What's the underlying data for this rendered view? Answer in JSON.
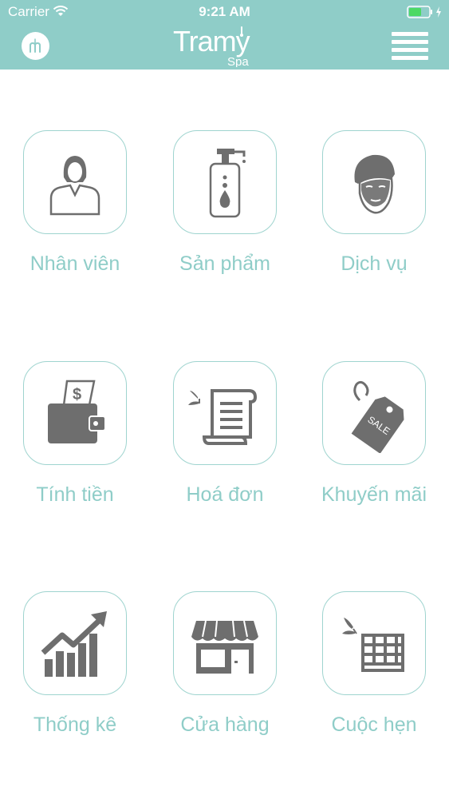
{
  "status_bar": {
    "carrier": "Carrier",
    "time": "9:21 AM"
  },
  "header": {
    "brand_name": "Tramy",
    "brand_sub": "Spa",
    "logo_glyph": "m",
    "menu_icon": "hamburger-menu-icon"
  },
  "colors": {
    "header_bg": "#8fcdc8",
    "accent": "#8fcdc8",
    "icon_gray": "#6e6e6e",
    "battery": "#4cd964"
  },
  "menu": {
    "items": [
      {
        "label": "Nhân viên",
        "icon": "staff-icon"
      },
      {
        "label": "Sản phẩm",
        "icon": "product-icon"
      },
      {
        "label": "Dịch vụ",
        "icon": "service-icon"
      },
      {
        "label": "Tính tiền",
        "icon": "checkout-icon"
      },
      {
        "label": "Hoá đơn",
        "icon": "invoice-icon"
      },
      {
        "label": "Khuyến mãi",
        "icon": "promotion-icon"
      },
      {
        "label": "Thống kê",
        "icon": "statistics-icon"
      },
      {
        "label": "Cửa hàng",
        "icon": "store-icon"
      },
      {
        "label": "Cuộc hẹn",
        "icon": "appointment-icon"
      }
    ],
    "sale_tag_text": "SALE"
  }
}
